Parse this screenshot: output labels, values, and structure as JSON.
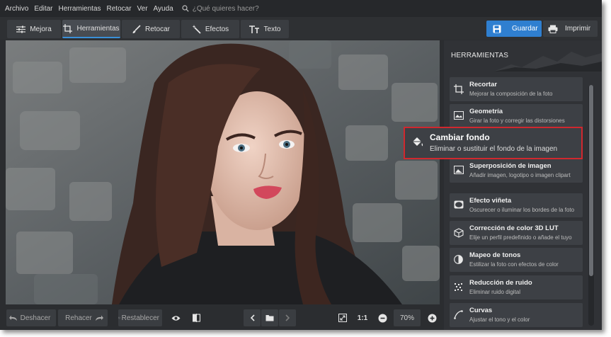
{
  "menu": {
    "items": [
      "Archivo",
      "Editar",
      "Herramientas",
      "Retocar",
      "Ver",
      "Ayuda"
    ],
    "search_placeholder": "¿Qué quieres hacer?"
  },
  "tabs": [
    {
      "label": "Mejora",
      "icon": "sliders-icon"
    },
    {
      "label": "Herramientas",
      "icon": "crop-icon",
      "active": true
    },
    {
      "label": "Retocar",
      "icon": "brush-icon"
    },
    {
      "label": "Efectos",
      "icon": "magic-wand-icon"
    },
    {
      "label": "Texto",
      "icon": "text-icon"
    }
  ],
  "actions": {
    "save": "Guardar",
    "print": "Imprimir"
  },
  "bottom": {
    "undo": "Deshacer",
    "redo": "Rehacer",
    "reset": "Restablecer",
    "ratio": "1:1",
    "zoom": "70%"
  },
  "panel": {
    "title": "HERRAMIENTAS",
    "tools": [
      {
        "title": "Recortar",
        "desc": "Mejorar la composición de la foto",
        "icon": "crop-icon"
      },
      {
        "title": "Geometría",
        "desc": "Girar la foto y corregir las distorsiones",
        "icon": "geometry-icon"
      },
      {
        "title": "Superposición de imagen",
        "desc": "Añadir imagen, logotipo o imagen clipart",
        "icon": "image-overlay-icon"
      },
      {
        "title": "Efecto viñeta",
        "desc": "Oscurecer o iluminar los bordes de la foto",
        "icon": "vignette-icon"
      },
      {
        "title": "Corrección de color 3D LUT",
        "desc": "Elije un perfil predefinido o añade el tuyo",
        "icon": "lut-cube-icon"
      },
      {
        "title": "Mapeo de tonos",
        "desc": "Estilizar la foto con efectos de color",
        "icon": "tone-mapping-icon"
      },
      {
        "title": "Reducción de ruido",
        "desc": "Eliminar ruido digital",
        "icon": "noise-icon"
      },
      {
        "title": "Curvas",
        "desc": "Ajustar el tono y el color",
        "icon": "curves-icon"
      }
    ],
    "highlight": {
      "title": "Cambiar fondo",
      "desc": "Eliminar o sustituir el fondo de la imagen",
      "icon": "paint-bucket-icon"
    }
  },
  "colors": {
    "accent": "#2f7fd0",
    "highlight_border": "#d0282e",
    "background": "#2b2d30"
  }
}
